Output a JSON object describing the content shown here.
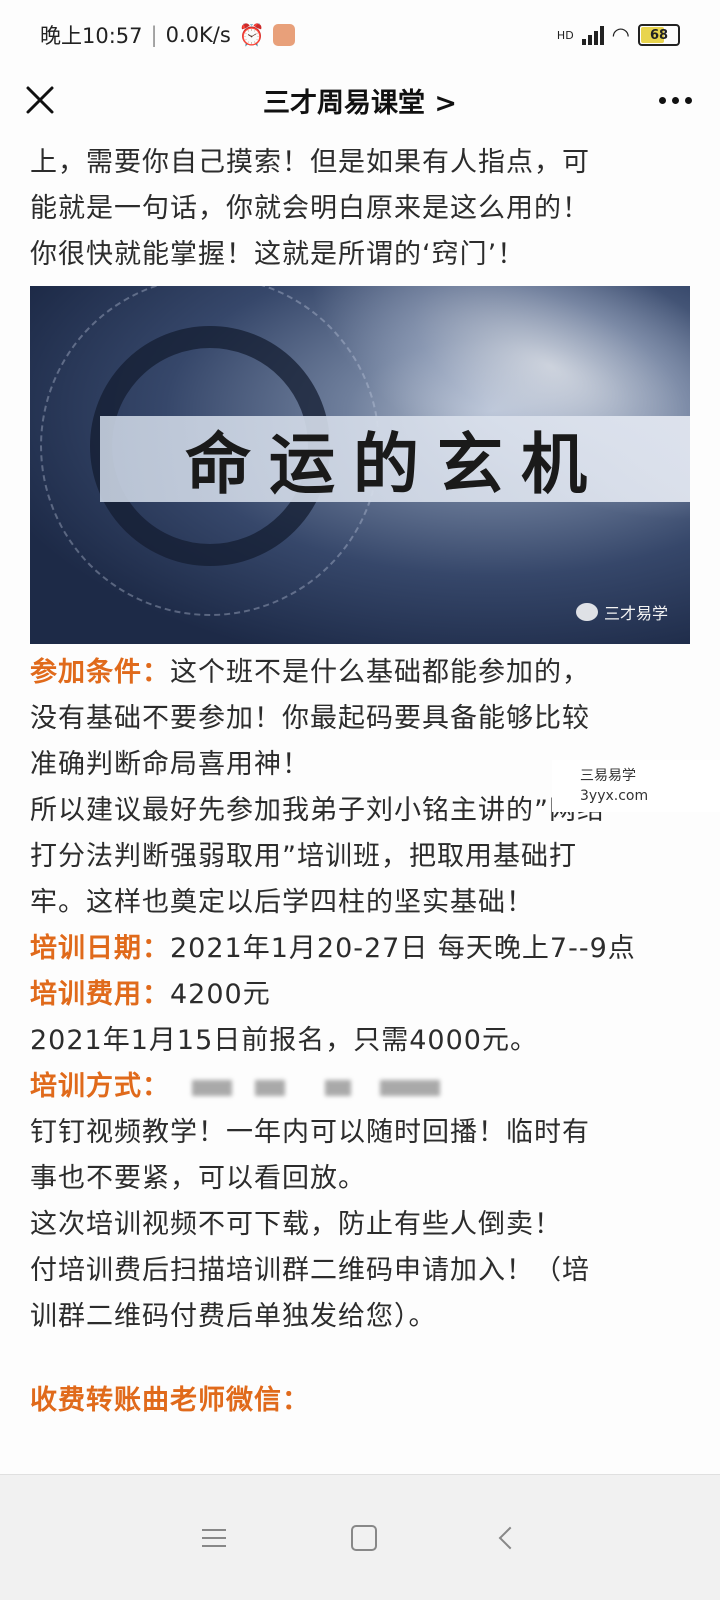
{
  "status_bar": {
    "time": "晚上10:57",
    "network_speed": "0.0K/s",
    "signal_label": "HD",
    "battery": "68"
  },
  "header": {
    "title": "三才周易课堂 >"
  },
  "article": {
    "intro_lines": [
      "上，需要你自己摸索！但是如果有人指点，可",
      "能就是一句话，你就会明白原来是这么用的！",
      "你很快就能掌握！这就是所谓的‘窍门’！"
    ],
    "banner": {
      "title_text": "命运的玄机",
      "watermark": "三才易学"
    },
    "conditions_label": "参加条件：",
    "conditions_lines": [
      "这个班不是什么基础都能参加的，",
      "没有基础不要参加！你最起码要具备能够比较",
      "准确判断命局喜用神！"
    ],
    "recommend_lines": [
      "所以建议最好先参加我弟子刘小铭主讲的”网络",
      "打分法判断强弱取用”培训班，把取用基础打",
      "牢。这样也奠定以后学四柱的坚实基础！"
    ],
    "date_label": "培训日期：",
    "date_value": "2021年1月20-27日 每天晚上7--9点",
    "fee_label": "培训费用：",
    "fee_value": "4200元",
    "early_line": "2021年1月15日前报名，只需4000元。",
    "method_label": "培训方式：",
    "method_lines": [
      "钉钉视频教学！一年内可以随时回播！临时有",
      "事也不要紧，可以看回放。",
      "这次培训视频不可下载，防止有些人倒卖！",
      "付培训费后扫描培训群二维码申请加入！（培",
      "训群二维码付费后单独发给您）。"
    ],
    "payment_label": "收费转账曲老师微信："
  },
  "overlay_watermark": {
    "line1": "三易易学",
    "line2": "3yyx.com"
  },
  "colors": {
    "accent": "#e06a1b",
    "text": "#2c2c2c"
  }
}
